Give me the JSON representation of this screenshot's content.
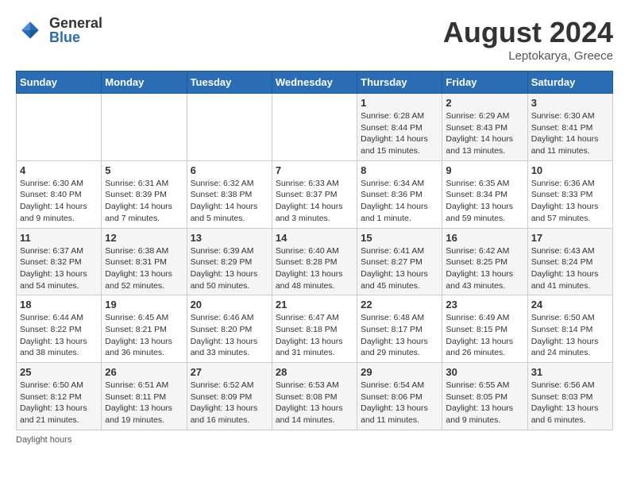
{
  "header": {
    "logo": {
      "general": "General",
      "blue": "Blue"
    },
    "title": "August 2024",
    "location": "Leptokarya, Greece"
  },
  "days_of_week": [
    "Sunday",
    "Monday",
    "Tuesday",
    "Wednesday",
    "Thursday",
    "Friday",
    "Saturday"
  ],
  "weeks": [
    [
      {
        "day": "",
        "info": ""
      },
      {
        "day": "",
        "info": ""
      },
      {
        "day": "",
        "info": ""
      },
      {
        "day": "",
        "info": ""
      },
      {
        "day": "1",
        "sunrise": "6:28 AM",
        "sunset": "8:44 PM",
        "daylight": "14 hours and 15 minutes."
      },
      {
        "day": "2",
        "sunrise": "6:29 AM",
        "sunset": "8:43 PM",
        "daylight": "14 hours and 13 minutes."
      },
      {
        "day": "3",
        "sunrise": "6:30 AM",
        "sunset": "8:41 PM",
        "daylight": "14 hours and 11 minutes."
      }
    ],
    [
      {
        "day": "4",
        "sunrise": "6:30 AM",
        "sunset": "8:40 PM",
        "daylight": "14 hours and 9 minutes."
      },
      {
        "day": "5",
        "sunrise": "6:31 AM",
        "sunset": "8:39 PM",
        "daylight": "14 hours and 7 minutes."
      },
      {
        "day": "6",
        "sunrise": "6:32 AM",
        "sunset": "8:38 PM",
        "daylight": "14 hours and 5 minutes."
      },
      {
        "day": "7",
        "sunrise": "6:33 AM",
        "sunset": "8:37 PM",
        "daylight": "14 hours and 3 minutes."
      },
      {
        "day": "8",
        "sunrise": "6:34 AM",
        "sunset": "8:36 PM",
        "daylight": "14 hours and 1 minute."
      },
      {
        "day": "9",
        "sunrise": "6:35 AM",
        "sunset": "8:34 PM",
        "daylight": "13 hours and 59 minutes."
      },
      {
        "day": "10",
        "sunrise": "6:36 AM",
        "sunset": "8:33 PM",
        "daylight": "13 hours and 57 minutes."
      }
    ],
    [
      {
        "day": "11",
        "sunrise": "6:37 AM",
        "sunset": "8:32 PM",
        "daylight": "13 hours and 54 minutes."
      },
      {
        "day": "12",
        "sunrise": "6:38 AM",
        "sunset": "8:31 PM",
        "daylight": "13 hours and 52 minutes."
      },
      {
        "day": "13",
        "sunrise": "6:39 AM",
        "sunset": "8:29 PM",
        "daylight": "13 hours and 50 minutes."
      },
      {
        "day": "14",
        "sunrise": "6:40 AM",
        "sunset": "8:28 PM",
        "daylight": "13 hours and 48 minutes."
      },
      {
        "day": "15",
        "sunrise": "6:41 AM",
        "sunset": "8:27 PM",
        "daylight": "13 hours and 45 minutes."
      },
      {
        "day": "16",
        "sunrise": "6:42 AM",
        "sunset": "8:25 PM",
        "daylight": "13 hours and 43 minutes."
      },
      {
        "day": "17",
        "sunrise": "6:43 AM",
        "sunset": "8:24 PM",
        "daylight": "13 hours and 41 minutes."
      }
    ],
    [
      {
        "day": "18",
        "sunrise": "6:44 AM",
        "sunset": "8:22 PM",
        "daylight": "13 hours and 38 minutes."
      },
      {
        "day": "19",
        "sunrise": "6:45 AM",
        "sunset": "8:21 PM",
        "daylight": "13 hours and 36 minutes."
      },
      {
        "day": "20",
        "sunrise": "6:46 AM",
        "sunset": "8:20 PM",
        "daylight": "13 hours and 33 minutes."
      },
      {
        "day": "21",
        "sunrise": "6:47 AM",
        "sunset": "8:18 PM",
        "daylight": "13 hours and 31 minutes."
      },
      {
        "day": "22",
        "sunrise": "6:48 AM",
        "sunset": "8:17 PM",
        "daylight": "13 hours and 29 minutes."
      },
      {
        "day": "23",
        "sunrise": "6:49 AM",
        "sunset": "8:15 PM",
        "daylight": "13 hours and 26 minutes."
      },
      {
        "day": "24",
        "sunrise": "6:50 AM",
        "sunset": "8:14 PM",
        "daylight": "13 hours and 24 minutes."
      }
    ],
    [
      {
        "day": "25",
        "sunrise": "6:50 AM",
        "sunset": "8:12 PM",
        "daylight": "13 hours and 21 minutes."
      },
      {
        "day": "26",
        "sunrise": "6:51 AM",
        "sunset": "8:11 PM",
        "daylight": "13 hours and 19 minutes."
      },
      {
        "day": "27",
        "sunrise": "6:52 AM",
        "sunset": "8:09 PM",
        "daylight": "13 hours and 16 minutes."
      },
      {
        "day": "28",
        "sunrise": "6:53 AM",
        "sunset": "8:08 PM",
        "daylight": "13 hours and 14 minutes."
      },
      {
        "day": "29",
        "sunrise": "6:54 AM",
        "sunset": "8:06 PM",
        "daylight": "13 hours and 11 minutes."
      },
      {
        "day": "30",
        "sunrise": "6:55 AM",
        "sunset": "8:05 PM",
        "daylight": "13 hours and 9 minutes."
      },
      {
        "day": "31",
        "sunrise": "6:56 AM",
        "sunset": "8:03 PM",
        "daylight": "13 hours and 6 minutes."
      }
    ]
  ],
  "footer": {
    "daylight_label": "Daylight hours"
  }
}
